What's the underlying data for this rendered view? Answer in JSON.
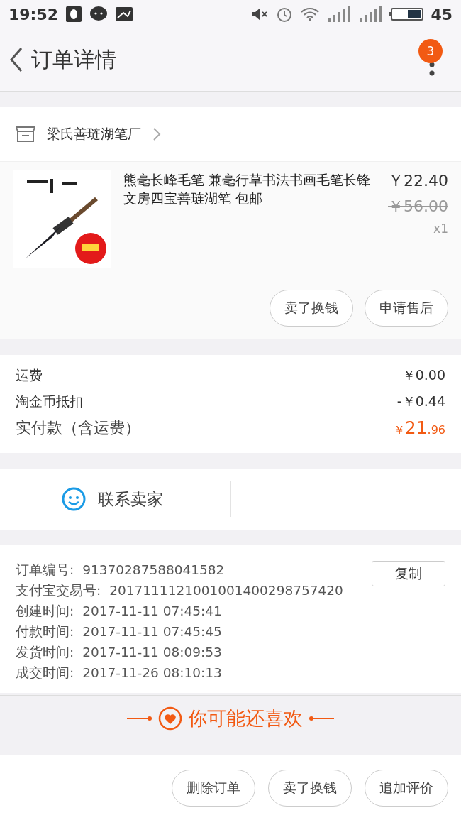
{
  "status_bar": {
    "time": "19:52",
    "battery": "45"
  },
  "header": {
    "title": "订单详情",
    "badge": "3"
  },
  "shop": {
    "name": "梁氏善琏湖笔厂"
  },
  "item": {
    "kind": "picture",
    "title": "熊毫长峰毛笔 兼毫行草书法书画毛笔长锋文房四宝善琏湖笔 包邮",
    "price": "￥22.40",
    "original_price": "￥56.00",
    "quantity": "x1",
    "actions": [
      "卖了换钱",
      "申请售后"
    ]
  },
  "costs": [
    {
      "label": "运费",
      "value": "￥0.00"
    },
    {
      "label": "淘金币抵扣",
      "value": "-￥0.44"
    }
  ],
  "total": {
    "label": "实付款（含运费）",
    "currency": "￥",
    "integer": "21",
    "decimal": ".96"
  },
  "contact": {
    "label": "联系卖家"
  },
  "order_info": [
    {
      "label": "订单编号:",
      "value": "91370287588041582"
    },
    {
      "label": "支付宝交易号:",
      "value": "2017111121001001400298757420"
    },
    {
      "label": "创建时间:",
      "value": "2017-11-11 07:45:41"
    },
    {
      "label": "付款时间:",
      "value": "2017-11-11 07:45:45"
    },
    {
      "label": "发货时间:",
      "value": "2017-11-11 08:09:53"
    },
    {
      "label": "成交时间:",
      "value": "2017-11-26 08:10:13"
    }
  ],
  "copy_button": "复制",
  "recommend": {
    "title": "你可能还喜欢"
  },
  "bottom_actions": [
    "删除订单",
    "卖了换钱",
    "追加评价"
  ]
}
